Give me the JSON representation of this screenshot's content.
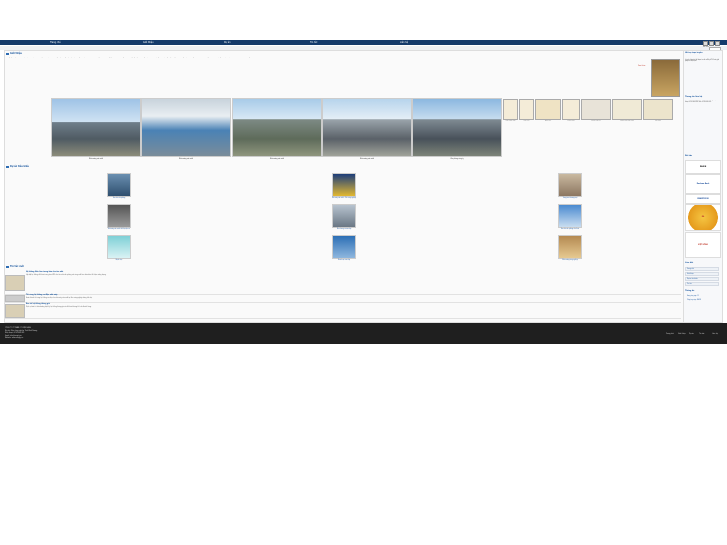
{
  "nav": {
    "items": [
      "Trang chủ",
      "Giới thiệu",
      "Dự án",
      "Tin tức",
      "Liên hệ"
    ]
  },
  "toolbar": {
    "text": "Tìm kiếm"
  },
  "intro": {
    "title": "Giới thiệu",
    "paragraph": "Công ty Cổ phần Cơ Điện Lạnh được thành lập với mục tiêu cung cấp các giải pháp hệ thống cơ điện, điều hòa không khí và thông gió cho các công trình công nghiệp, thương mại và dân dụng. Với đội ngũ kỹ sư giàu kinh nghiệm, chúng tôi cam kết mang đến chất lượng và dịch vụ tốt nhất cho khách hàng.",
    "more": "Xem thêm"
  },
  "photos": [
    {
      "caption": "Nhà xưởng sản xuất"
    },
    {
      "caption": "Nhà xưởng sản xuất"
    },
    {
      "caption": "Nhà xưởng sản xuất"
    },
    {
      "caption": "Nhà xưởng sản xuất"
    },
    {
      "caption": "Văn phòng công ty"
    }
  ],
  "certificates": [
    {
      "caption": "Giấy chứng nhận"
    },
    {
      "caption": "Giấy khen"
    },
    {
      "caption": "Bằng khen"
    },
    {
      "caption": "Chứng nhận"
    },
    {
      "caption": "Chứng nhận ISO"
    },
    {
      "caption": "Chứng nhận chất lượng"
    },
    {
      "caption": "Giấy phép"
    }
  ],
  "projects": {
    "title": "Dự án tiêu biểu",
    "items": [
      {
        "caption": "Tòa nhà văn phòng"
      },
      {
        "caption": "Nhà máy sản xuất - Khu công nghiệp"
      },
      {
        "caption": "Trung tâm thương mại"
      },
      {
        "caption": "Nhà máy sản xuất thiết bị điện tử"
      },
      {
        "caption": "Khu chung cư cao cấp"
      },
      {
        "caption": "Tòa nhà văn phòng cho thuê"
      },
      {
        "caption": "Bệnh viện"
      },
      {
        "caption": "Khách sạn cao cấp"
      },
      {
        "caption": "Nhà xưởng công nghiệp"
      }
    ]
  },
  "news": {
    "title": "Tin tức mới",
    "items": [
      {
        "title": "Hệ thống điều hòa trung tâm cho tòa nhà",
        "text": "Lắp đặt hệ thống điều hòa trung tâm VRV cho tòa nhà văn phòng với công suất lớn, đảm bảo tiết kiệm năng lượng."
      },
      {
        "title": "Thi công hệ thống cơ điện nhà máy",
        "text": "Hoàn thành thi công hệ thống cơ điện cho nhà máy sản xuất tại khu công nghiệp đúng tiến độ."
      },
      {
        "title": "Bảo trì hệ thống thông gió",
        "text": "Dịch vụ bảo trì, bảo dưỡng định kỳ hệ thống thông gió và điều hòa không khí cho khách hàng."
      }
    ]
  },
  "sidebar": {
    "support_title": "Hỗ trợ trực tuyến",
    "support_text": "Hotline: 0909 000 000. Email: info@congty.vn. Liên hệ với chúng tôi để được tư vấn miễn phí về các giải pháp cơ điện lạnh.",
    "contact_title": "Thông tin liên hệ",
    "contact_text": "Địa chỉ: Khu công nghiệp, Tỉnh Bình Dương. Điện thoại: 0274 000 000. Fax: 0274 000 001.",
    "partners_title": "Đối tác",
    "partners": [
      "DAIKIN",
      "Dunham-Bush",
      "SMARTDOOR",
      "ĐA",
      "VIỆT HỒNG"
    ],
    "links_title": "Liên kết",
    "links": [
      "Trang chủ",
      "Giới thiệu",
      "Dự án tiêu biểu",
      "Tin tức"
    ],
    "stats_title": "Thống kê",
    "stats": [
      "Đang truy cập: 12",
      "Tổng truy cập: 45678"
    ]
  },
  "footer": {
    "lines": [
      "CÔNG TY CỔ PHẦN CƠ ĐIỆN LẠNH",
      "Địa chỉ: Khu công nghiệp, Tỉnh Bình Dương",
      "Điện thoại: 0274 000 000",
      "Email: info@congty.vn",
      "Website: www.congty.vn"
    ],
    "links": [
      "Trang chủ",
      "Giới thiệu",
      "Dự án",
      "Tin tức",
      "Liên hệ"
    ]
  },
  "colors": {
    "nav": "#143a6b",
    "accent": "#1e5aa0",
    "footer": "#1f1f1f"
  }
}
